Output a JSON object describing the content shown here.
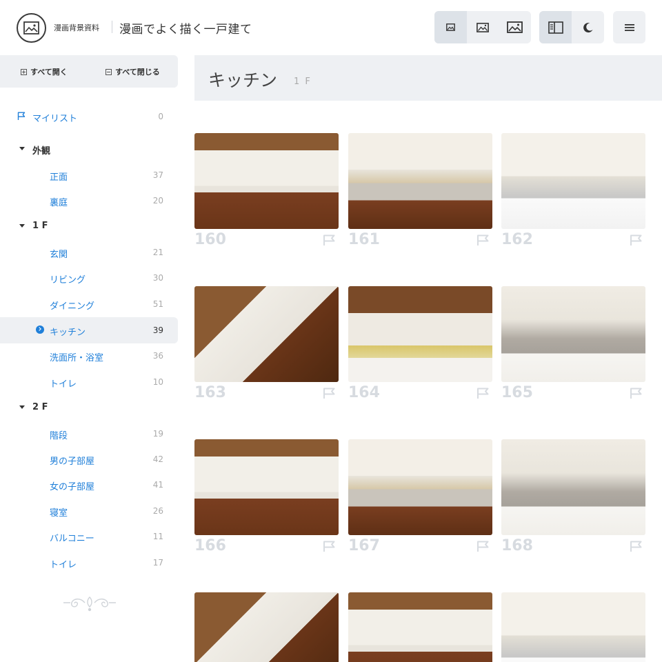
{
  "header": {
    "site_name": "漫画背景資料",
    "page_title": "漫画でよく描く一戸建て",
    "size_buttons": [
      "small-image-icon",
      "medium-image-icon",
      "large-image-icon"
    ],
    "view_buttons": [
      "sidebar-icon",
      "moon-icon"
    ],
    "menu_icon": "hamburger-menu-icon"
  },
  "sidebar": {
    "expand_all": "すべて開く",
    "collapse_all": "すべて閉じる",
    "mylist": {
      "label": "マイリスト",
      "count": "0"
    },
    "groups": [
      {
        "label": "外観",
        "items": [
          {
            "label": "正面",
            "count": "37"
          },
          {
            "label": "裏庭",
            "count": "20"
          }
        ]
      },
      {
        "label": "1 F",
        "items": [
          {
            "label": "玄関",
            "count": "21"
          },
          {
            "label": "リビング",
            "count": "30"
          },
          {
            "label": "ダイニング",
            "count": "51"
          },
          {
            "label": "キッチン",
            "count": "39"
          },
          {
            "label": "洗面所・浴室",
            "count": "36"
          },
          {
            "label": "トイレ",
            "count": "10"
          }
        ]
      },
      {
        "label": "2 F",
        "items": [
          {
            "label": "階段",
            "count": "19"
          },
          {
            "label": "男の子部屋",
            "count": "42"
          },
          {
            "label": "女の子部屋",
            "count": "41"
          },
          {
            "label": "寝室",
            "count": "26"
          },
          {
            "label": "バルコニー",
            "count": "11"
          },
          {
            "label": "トイレ",
            "count": "17"
          }
        ]
      }
    ]
  },
  "main": {
    "category_title": "キッチン",
    "category_floor": "1 F",
    "photos": [
      {
        "num": "160"
      },
      {
        "num": "161"
      },
      {
        "num": "162"
      },
      {
        "num": "163"
      },
      {
        "num": "164"
      },
      {
        "num": "165"
      },
      {
        "num": "166"
      },
      {
        "num": "167"
      },
      {
        "num": "168"
      },
      {
        "num": ""
      },
      {
        "num": ""
      },
      {
        "num": ""
      }
    ]
  },
  "colors": {
    "accent": "#1f7fd9",
    "panel_bg": "#eef0f3",
    "muted_number": "#d7dbe0"
  }
}
